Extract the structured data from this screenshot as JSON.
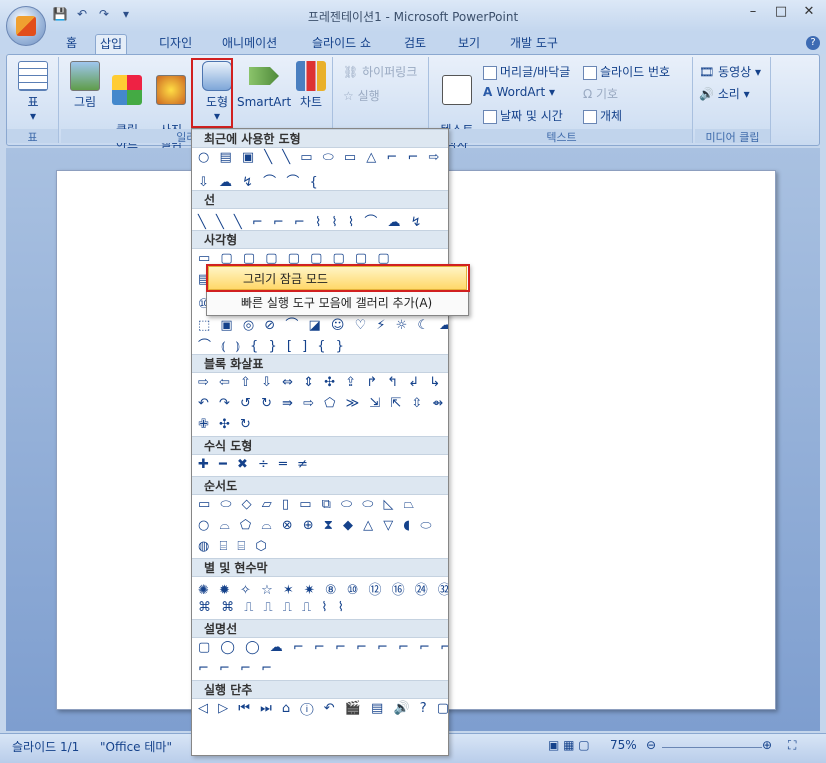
{
  "window": {
    "title": "프레젠테이션1 - Microsoft PowerPoint",
    "min": "–",
    "max": "□",
    "close": "✕"
  },
  "qat": {
    "save": "💾",
    "undo": "↶",
    "redo": "↷",
    "more": "▾"
  },
  "tabs": [
    "홈",
    "삽입",
    "디자인",
    "애니메이션",
    "슬라이드 쇼",
    "검토",
    "보기",
    "개발 도구"
  ],
  "ribbon": {
    "table_group": {
      "button": "표",
      "label": "표"
    },
    "illustration_group": {
      "picture": "그림",
      "clipart": "클립\n아트",
      "album": "사진\n앨범",
      "shapes": "도형",
      "smartart": "SmartArt",
      "chart": "차트",
      "label": "일러스트"
    },
    "links_group": {
      "hyperlink": "하이퍼링크",
      "action": "실행"
    },
    "text_group": {
      "textbox": "텍스트\n상자",
      "header_footer": "머리글/바닥글",
      "wordart": "WordArt",
      "datetime": "날짜 및 시간",
      "slide_number": "슬라이드 번호",
      "symbol": "기호",
      "object": "개체",
      "label": "텍스트"
    },
    "media_group": {
      "movie": "동영상",
      "sound": "소리",
      "label": "미디어 클립"
    }
  },
  "gallery": {
    "sections": [
      {
        "title": "최근에 사용한 도형",
        "rows": [
          "○ ▤ ▣ ╲ ╲ ▭ ⬭ ▭ △ ⌐ ⌐ ⇨",
          "⇩ ☁ ↯ ⌒ ⌒ {"
        ]
      },
      {
        "title": "선",
        "rows": [
          "╲ ╲ ╲ ⌐ ⌐ ⌐ ⌇ ⌇ ⌇ ⌒ ☁ ↯"
        ]
      },
      {
        "title": "사각형",
        "rows": [
          "▭ ▢ ▢ ▢ ▢ ▢ ▢ ▢ ▢"
        ]
      },
      {
        "title": "",
        "rows": [
          "▤ ○ △ ◺ ▱ ◇ ⬡ ⬢ ⊕ ⊖ ○ ◑",
          "⑩ ⑫ ◔ ◕ ◧ ▣ ⌐ ⌐ ⟋ ✚ ⬡ ⌸",
          "⬚ ▣ ◎ ⊘ ⌒ ◪ ☺ ♡ ⚡ ☼ ☾ ☁",
          "⌒ ⦅ ⦆ { } [ ] { }"
        ]
      },
      {
        "title": "블록 화살표",
        "rows": [
          "⇨ ⇦ ⇧ ⇩ ⇔ ⇕ ✣ ⇪ ↱ ↰ ↲ ↳",
          "↶ ↷ ↺ ↻ ⇛ ⇨ ⬠ ≫ ⇲ ⇱ ⇳ ⇴",
          "✙ ✣ ↻"
        ]
      },
      {
        "title": "수식 도형",
        "rows": [
          "✚ ━ ✖ ÷ ═ ≠"
        ]
      },
      {
        "title": "순서도",
        "rows": [
          "▭ ⬭ ◇ ▱ ▯ ▭ ⧉ ⬭ ⬭ ◺ ⏢",
          "○ ⌓ ⬠ ⌓ ⊗ ⊕ ⧗ ◆ △ ▽ ◖ ⬭",
          "◍ ⌸ ⌸ ⬡"
        ]
      },
      {
        "title": "별 및 현수막",
        "rows": [
          "✺ ✹ ✧ ☆ ✶ ✷ ⑧ ⑩ ⑫ ⑯ ㉔ ㉜",
          "⌘ ⌘ ⎍ ⎍ ⎍ ⎍ ⌇ ⌇"
        ]
      },
      {
        "title": "설명선",
        "rows": [
          "▢ ◯ ◯ ☁ ⌐ ⌐ ⌐ ⌐ ⌐ ⌐ ⌐ ⌐",
          "⌐ ⌐ ⌐ ⌐"
        ]
      },
      {
        "title": "실행 단추",
        "rows": [
          "◁ ▷ ⏮ ⏭ ⌂ ⓘ ↶ 🎬 ▤ 🔊 ? ▢"
        ]
      }
    ]
  },
  "context_menu": {
    "lock_mode": "그리기 잠금 모드",
    "add_qat": "빠른 실행 도구 모음에 갤러리 추가(A)"
  },
  "status": {
    "slide": "슬라이드 1/1",
    "theme": "\"Office 테마\"",
    "zoom": "75%"
  }
}
